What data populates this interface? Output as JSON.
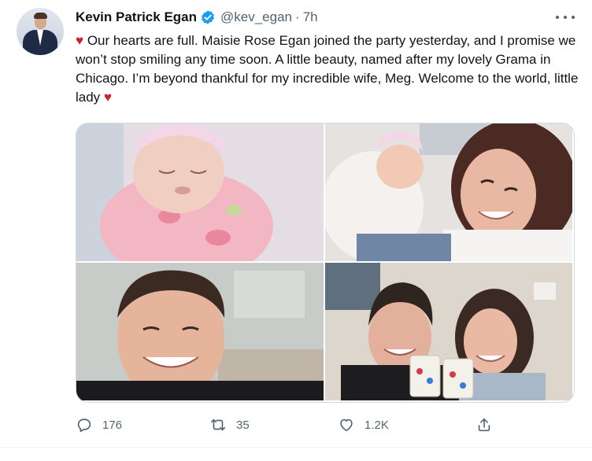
{
  "tweet": {
    "author_name": "Kevin Patrick Egan",
    "handle": "@kev_egan",
    "separator": "·",
    "time": "7h",
    "heart_emoji": "♥",
    "text": "Our hearts are full. Maisie Rose Egan joined the party yesterday, and I promise we won’t stop smiling any time soon. A little beauty, named after my lovely Grama in Chicago. I’m beyond thankful for my incredible wife, Meg. Welcome to the world, little lady",
    "verified_color": "#1d9bf0",
    "heart_color": "#d01f2f"
  },
  "media": [
    {
      "icon": "photo-newborn-swaddled"
    },
    {
      "icon": "photo-mother-with-newborn"
    },
    {
      "icon": "photo-father-selfie"
    },
    {
      "icon": "photo-couple-with-cups"
    }
  ],
  "actions": {
    "reply_count": "176",
    "retweet_count": "35",
    "like_count": "1.2K"
  }
}
